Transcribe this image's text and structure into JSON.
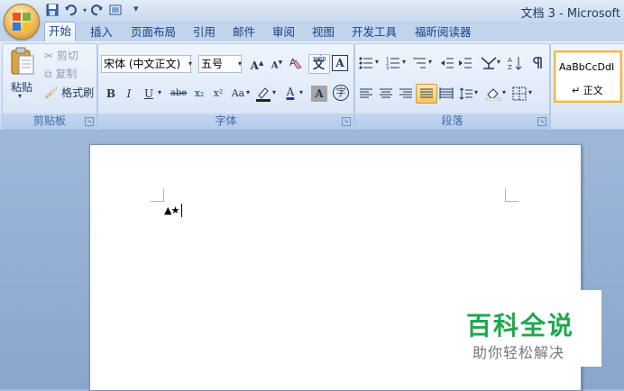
{
  "window": {
    "title": "文档 3 - Microsoft"
  },
  "quick_access": {
    "separator": "▾"
  },
  "tabs": [
    "开始",
    "插入",
    "页面布局",
    "引用",
    "邮件",
    "审阅",
    "视图",
    "开发工具",
    "福昕阅读器"
  ],
  "active_tab": "开始",
  "clipboard": {
    "paste_label": "粘贴",
    "cut_label": "剪切",
    "copy_label": "复制",
    "format_painter_label": "格式刷",
    "group_label": "剪贴板"
  },
  "font": {
    "font_name": "宋体 (中文正文)",
    "font_size": "五号",
    "grow": "A",
    "shrink": "A",
    "phonetic": "wén",
    "clear": "A",
    "border_char": "A",
    "bold": "B",
    "italic": "I",
    "underline": "U",
    "strike": "abe",
    "subscript": "x₂",
    "superscript": "x²",
    "change_case": "Aa",
    "font_color": "A",
    "shading": "A",
    "enclose": "字",
    "group_label": "字体"
  },
  "paragraph": {
    "group_label": "段落"
  },
  "styles": {
    "tile_preview": "AaBbCcDdI",
    "tile_name": "↵ 正文"
  },
  "document": {
    "typed_text": "▲★"
  },
  "watermark": {
    "title": "百科全说",
    "subtitle": "助你轻松解决"
  },
  "colors": {
    "ribbon_bg": "#dbe6f6",
    "accent_text": "#15428b",
    "watermark_green": "#1fa84f",
    "selected_style_border": "#f4b740"
  }
}
